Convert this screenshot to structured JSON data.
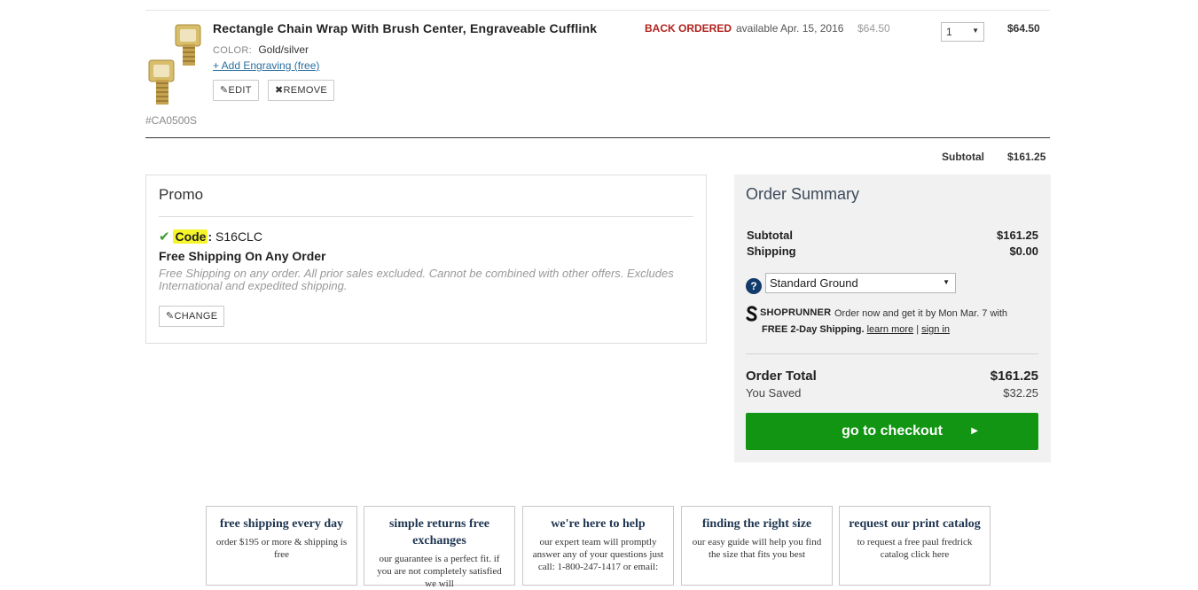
{
  "cart_item": {
    "title": "Rectangle Chain Wrap With Brush Center, Engraveable Cufflink",
    "color_label": "COLOR:",
    "color_value": "Gold/silver",
    "engraving_link": "+ Add Engraving (free)",
    "edit_label": "EDIT",
    "remove_label": "REMOVE",
    "sku": "#CA0500S",
    "stock_status": "BACK ORDERED",
    "availability": "available Apr. 15, 2016",
    "unit_price": "$64.50",
    "quantity": "1",
    "line_total": "$64.50"
  },
  "cart_subtotal": {
    "label": "Subtotal",
    "value": "$161.25"
  },
  "promo": {
    "title": "Promo",
    "code_label": "Code",
    "code_value": "S16CLC",
    "headline": "Free Shipping On Any Order",
    "description": "Free Shipping on any order. All prior sales excluded. Cannot be combined with other offers. Excludes International and expedited shipping.",
    "change_label": "CHANGE"
  },
  "order_summary": {
    "title": "Order Summary",
    "subtotal_label": "Subtotal",
    "subtotal_value": "$161.25",
    "shipping_label": "Shipping",
    "shipping_value": "$0.00",
    "shipping_method": "Standard Ground",
    "help_glyph": "?",
    "shoprunner_brand": "SHOPRUNNER",
    "shoprunner_text1": "Order now and get it by Mon Mar. 7 with",
    "shoprunner_bold": "FREE 2-Day Shipping.",
    "learn_more": "learn more",
    "separator": "|",
    "sign_in": "sign in",
    "total_label": "Order Total",
    "total_value": "$161.25",
    "saved_label": "You Saved",
    "saved_value": "$32.25",
    "checkout_label": "go to checkout"
  },
  "footer_boxes": [
    {
      "title": "free shipping every day",
      "text": "order $195 or more & shipping is free"
    },
    {
      "title": "simple returns free exchanges",
      "text": "our guarantee is a perfect fit. if you are not completely satisfied we will"
    },
    {
      "title": "we're here to help",
      "text": "our expert team will promptly answer any of your questions just call: 1-800-247-1417 or email:"
    },
    {
      "title": "finding the right size",
      "text": "our easy guide will help you find the size that fits you best"
    },
    {
      "title": "request our print catalog",
      "text": "to request a free paul fredrick catalog click here"
    }
  ],
  "colors": {
    "back_ordered": "#b0221d",
    "checkout_green": "#129512",
    "summary_bg": "#f1f1f1",
    "highlight": "#f5f52a"
  }
}
